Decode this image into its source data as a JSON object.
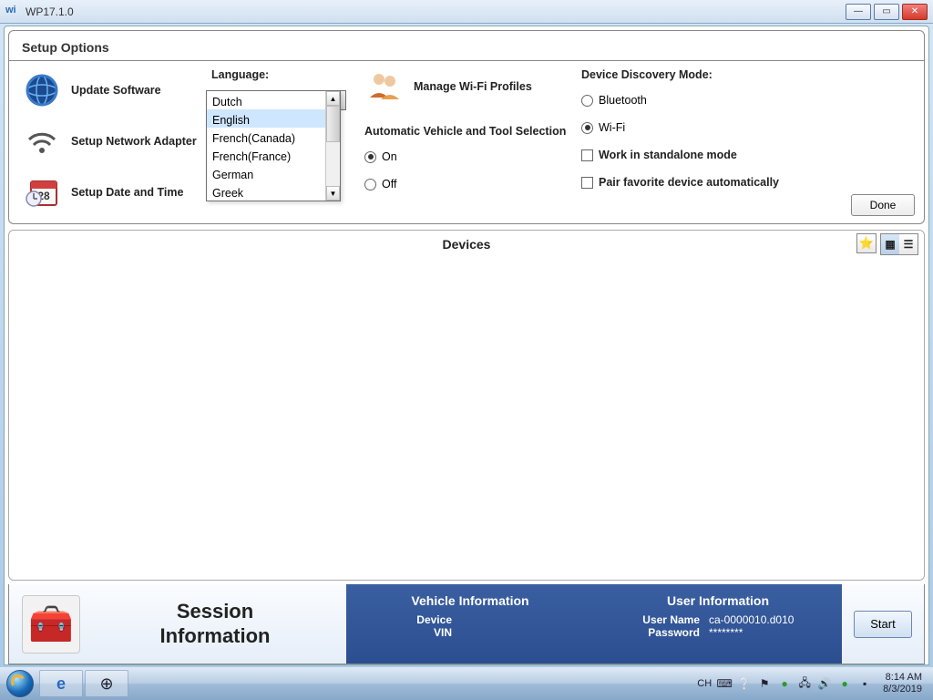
{
  "window": {
    "title": "WP17.1.0"
  },
  "setup": {
    "title": "Setup Options",
    "left_items": [
      {
        "label": "Update Software"
      },
      {
        "label": "Setup Network Adapter"
      },
      {
        "label": "Setup Date and Time"
      }
    ],
    "language_label": "Language:",
    "language_selected": "English",
    "language_options": [
      "Dutch",
      "English",
      "French(Canada)",
      "French(France)",
      "German",
      "Greek"
    ],
    "manage_wifi": "Manage Wi-Fi Profiles",
    "auto_select_label": "Automatic Vehicle and Tool Selection",
    "auto_on": "On",
    "auto_off": "Off",
    "auto_value": "On",
    "discovery_label": "Device Discovery Mode:",
    "discovery_bluetooth": "Bluetooth",
    "discovery_wifi": "Wi-Fi",
    "discovery_value": "Wi-Fi",
    "standalone_label": "Work in standalone mode",
    "pair_label": "Pair favorite device automatically",
    "done": "Done"
  },
  "devices": {
    "title": "Devices"
  },
  "session": {
    "label": "Session\nInformation",
    "label_line1": "Session",
    "label_line2": "Information"
  },
  "vehicle": {
    "title": "Vehicle Information",
    "device_k": "Device",
    "device_v": "",
    "vin_k": "VIN",
    "vin_v": ""
  },
  "user": {
    "title": "User Information",
    "name_k": "User Name",
    "name_v": "ca-0000010.d010",
    "pass_k": "Password",
    "pass_v": "********"
  },
  "start": "Start",
  "tray": {
    "lang": "CH",
    "time": "8:14 AM",
    "date": "8/3/2019"
  }
}
